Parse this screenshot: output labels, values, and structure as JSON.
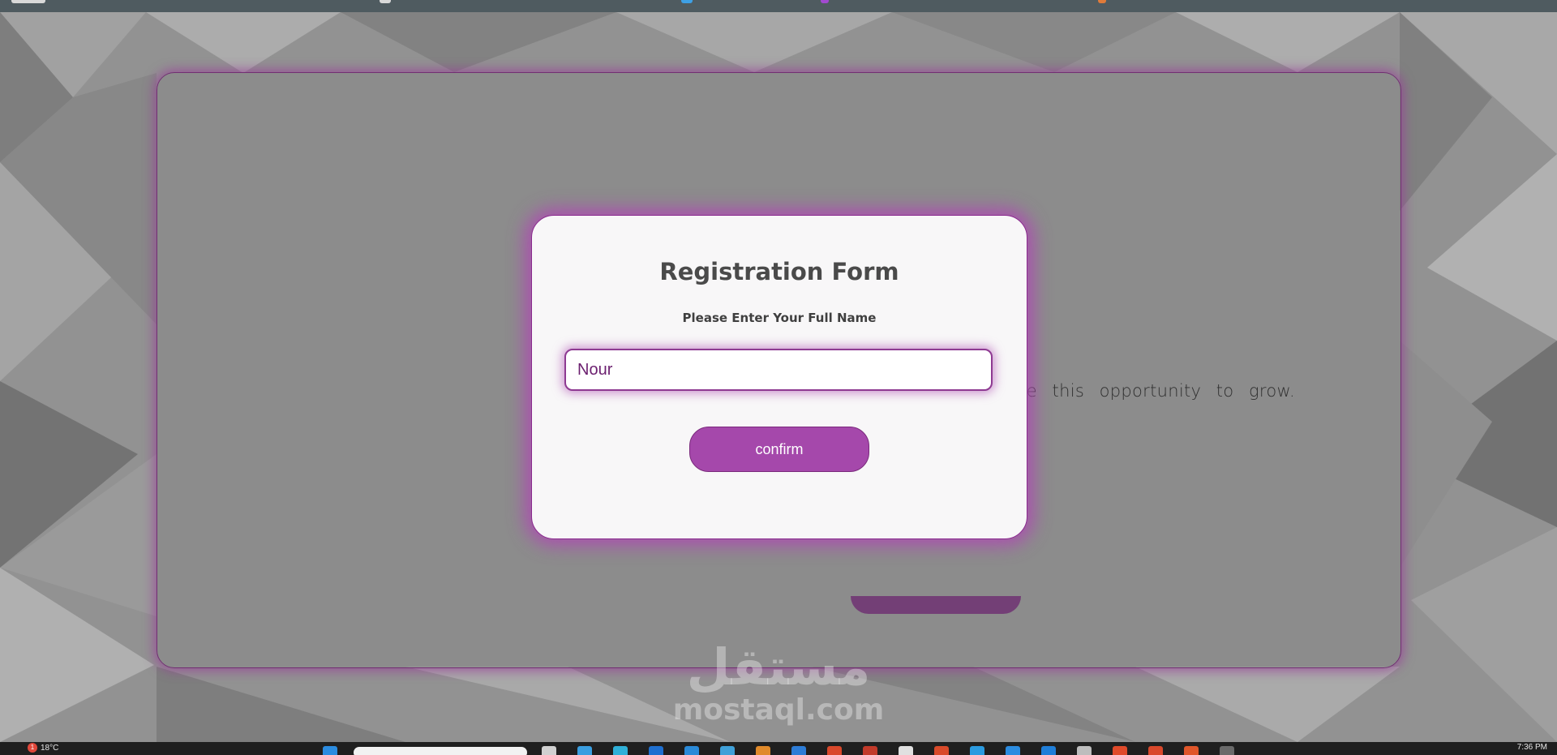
{
  "background": {
    "card_text": "Get ready to unleash your potential and take this opportunity to grow."
  },
  "modal": {
    "title": "Registration Form",
    "subtitle": "Please Enter Your Full Name",
    "name_input_value": "Nour",
    "confirm_label": "confirm"
  },
  "watermark": {
    "arabic": "مستقل",
    "site": "mostaql.com"
  },
  "taskbar": {
    "weather": "18°C",
    "notification_count": "1",
    "clock": "7:36 PM"
  },
  "colors": {
    "accent": "#a548ab",
    "border": "#8a2a8e",
    "glow": "#b046b4"
  }
}
